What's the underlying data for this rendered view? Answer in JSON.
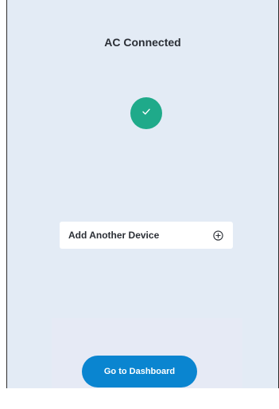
{
  "screen": {
    "title": "AC Connected",
    "status_icon": "check-icon",
    "accent_color": "#1faa8a"
  },
  "add_device": {
    "label": "Add Another Device",
    "icon": "plus-circle-icon"
  },
  "footer": {
    "primary_button_label": "Go to Dashboard",
    "primary_button_color": "#0a85d0"
  }
}
